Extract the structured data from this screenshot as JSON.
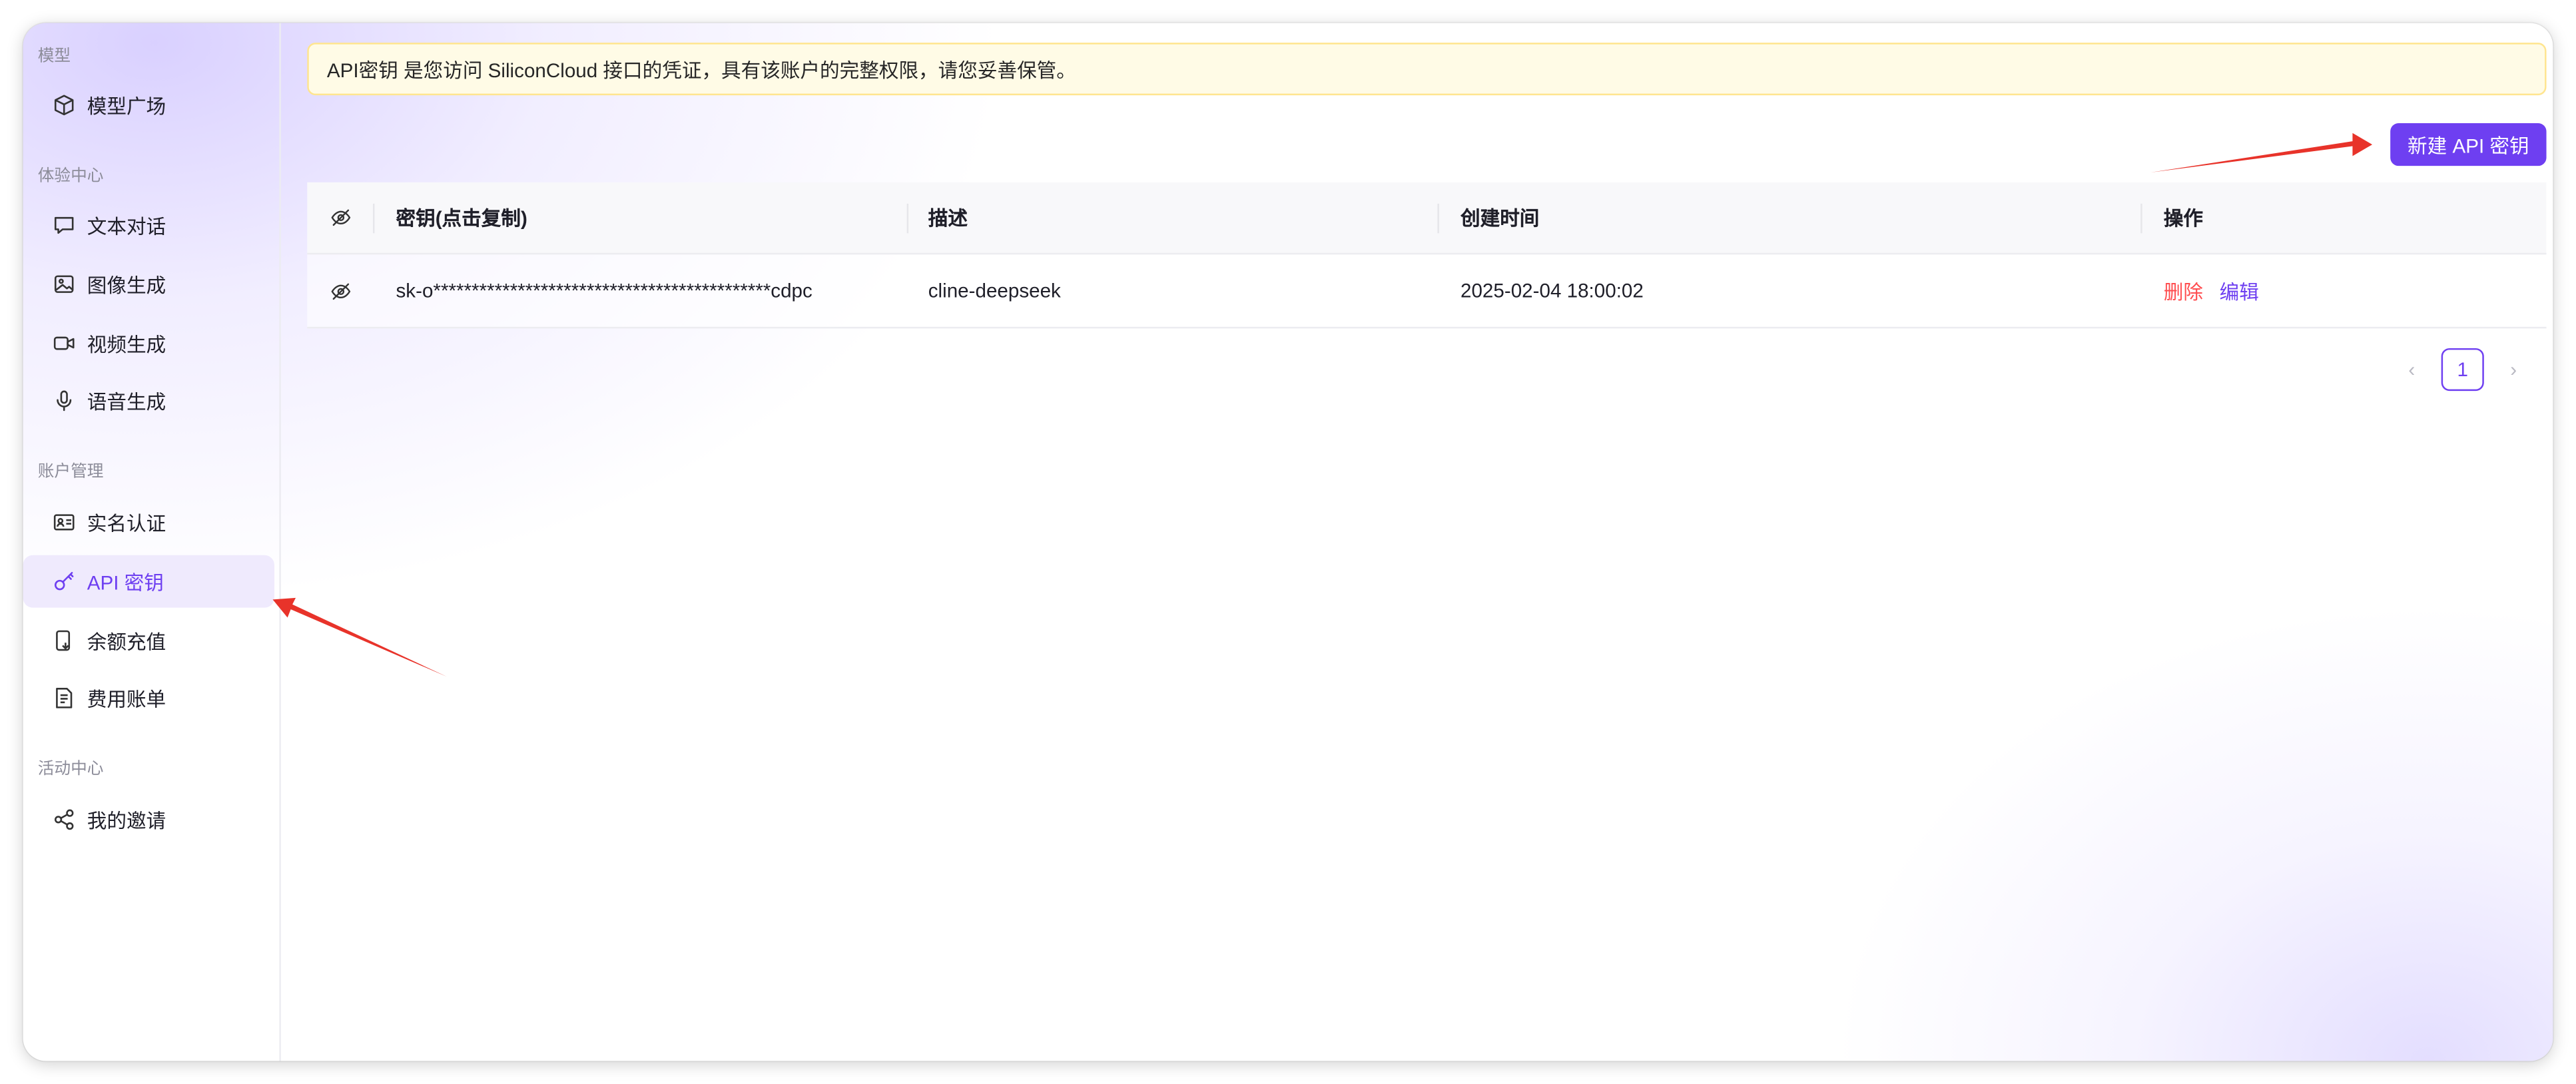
{
  "sidebar": {
    "groups": [
      {
        "title": "模型",
        "items": [
          {
            "label": "模型广场",
            "icon": "cube-icon"
          }
        ]
      },
      {
        "title": "体验中心",
        "items": [
          {
            "label": "文本对话",
            "icon": "chat-bubble-icon"
          },
          {
            "label": "图像生成",
            "icon": "image-icon"
          },
          {
            "label": "视频生成",
            "icon": "video-camera-icon"
          },
          {
            "label": "语音生成",
            "icon": "microphone-icon"
          }
        ]
      },
      {
        "title": "账户管理",
        "items": [
          {
            "label": "实名认证",
            "icon": "id-card-icon"
          },
          {
            "label": "API 密钥",
            "icon": "key-icon",
            "active": true
          },
          {
            "label": "余额充值",
            "icon": "wallet-icon"
          },
          {
            "label": "费用账单",
            "icon": "bill-icon"
          }
        ]
      },
      {
        "title": "活动中心",
        "items": [
          {
            "label": "我的邀请",
            "icon": "share-icon"
          }
        ]
      }
    ]
  },
  "notice": {
    "text": "API密钥 是您访问 SiliconCloud 接口的凭证，具有该账户的完整权限，请您妥善保管。"
  },
  "toolbar": {
    "new_key_label": "新建 API 密钥"
  },
  "table": {
    "columns": [
      "密钥(点击复制)",
      "描述",
      "创建时间",
      "操作"
    ],
    "rows": [
      {
        "key": "sk-o********************************************cdpc",
        "description": "cline-deepseek",
        "created": "2025-02-04 18:00:02",
        "actions": {
          "delete": "删除",
          "edit": "编辑"
        }
      }
    ]
  },
  "pagination": {
    "current": "1",
    "prev": "‹",
    "next": "›"
  },
  "colors": {
    "accent": "#6e3ff1",
    "danger": "#ff4d4f",
    "notice_bg": "#fffbe6",
    "notice_border": "#ffe58f",
    "annotation_arrow": "#e8332a"
  }
}
